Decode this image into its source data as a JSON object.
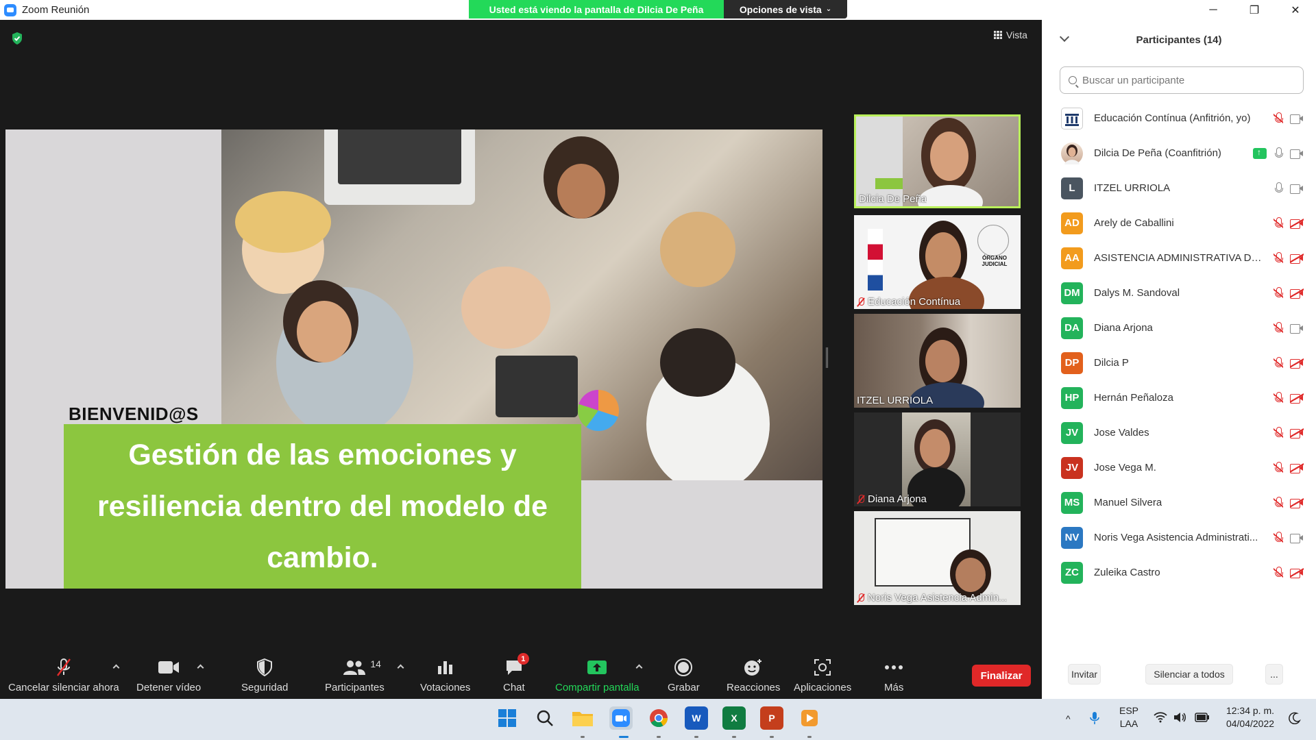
{
  "window": {
    "app_title": "Zoom Reunión",
    "viewing_banner": "Usted está viendo la pantalla de Dilcia De Peña",
    "view_options": "Opciones de vista",
    "view_button": "Vista",
    "controls": {
      "minimize": "─",
      "restore": "❐",
      "close": "✕"
    }
  },
  "slide": {
    "welcome": "BIENVENID@S",
    "title": "Gestión de las emociones y resiliencia dentro del modelo de cambio.",
    "title_bg": "#8cc63f"
  },
  "tiles": [
    {
      "name": "Dilcia De Peña",
      "muted": false,
      "active": true
    },
    {
      "name": "Educación Contínua",
      "muted": true,
      "active": false,
      "logo_text": "ÓRGANO JUDICIAL"
    },
    {
      "name": "ITZEL URRIOLA",
      "muted": false,
      "active": false
    },
    {
      "name": "Diana Arjona",
      "muted": true,
      "active": false
    },
    {
      "name": "Noris Vega Asistencia Admin...",
      "muted": true,
      "active": false
    }
  ],
  "participants_panel": {
    "title": "Participantes (14)",
    "search_placeholder": "Buscar un participante",
    "items": [
      {
        "initials": "",
        "avatar": "logo",
        "name": "Educación Contínua (Anfitrión, yo)",
        "mic": "off",
        "cam": "on",
        "sharing": false
      },
      {
        "initials": "",
        "avatar": "photo",
        "name": "Dilcia De Peña (Coanfitrión)",
        "mic": "on",
        "cam": "on",
        "sharing": true
      },
      {
        "initials": "L",
        "color": "#4a5560",
        "name": "ITZEL URRIOLA",
        "mic": "on",
        "cam": "on",
        "sharing": false
      },
      {
        "initials": "AD",
        "color": "#f29b1d",
        "name": "Arely de Caballini",
        "mic": "off",
        "cam": "off",
        "sharing": false
      },
      {
        "initials": "AA",
        "color": "#f29b1d",
        "name": "ASISTENCIA ADMINISTRATIVA DE ...",
        "mic": "off",
        "cam": "off",
        "sharing": false
      },
      {
        "initials": "DM",
        "color": "#23b35b",
        "name": "Dalys M. Sandoval",
        "mic": "off",
        "cam": "off",
        "sharing": false
      },
      {
        "initials": "DA",
        "color": "#23b35b",
        "name": "Diana Arjona",
        "mic": "off",
        "cam": "on",
        "sharing": false
      },
      {
        "initials": "DP",
        "color": "#e2601c",
        "name": "Dilcia P",
        "mic": "off",
        "cam": "off",
        "sharing": false
      },
      {
        "initials": "HP",
        "color": "#23b35b",
        "name": "Hernán Peñaloza",
        "mic": "off",
        "cam": "off",
        "sharing": false
      },
      {
        "initials": "JV",
        "color": "#23b35b",
        "name": "Jose Valdes",
        "mic": "off",
        "cam": "off",
        "sharing": false
      },
      {
        "initials": "JV",
        "color": "#c9321f",
        "name": "Jose Vega M.",
        "mic": "off",
        "cam": "off",
        "sharing": false
      },
      {
        "initials": "MS",
        "color": "#23b35b",
        "name": "Manuel Silvera",
        "mic": "off",
        "cam": "off",
        "sharing": false
      },
      {
        "initials": "NV",
        "color": "#2b78c2",
        "name": "Noris Vega Asistencia Administrati...",
        "mic": "off",
        "cam": "on",
        "sharing": false
      },
      {
        "initials": "ZC",
        "color": "#23b35b",
        "name": "Zuleika Castro",
        "mic": "off",
        "cam": "off",
        "sharing": false
      }
    ],
    "buttons": {
      "invite": "Invitar",
      "mute_all": "Silenciar a todos",
      "more": "..."
    }
  },
  "toolbar": {
    "unmute": "Cancelar silenciar ahora",
    "stop_video": "Detener vídeo",
    "security": "Seguridad",
    "participants": "Participantes",
    "participants_count": "14",
    "polls": "Votaciones",
    "chat": "Chat",
    "chat_badge": "1",
    "share": "Compartir pantalla",
    "record": "Grabar",
    "reactions": "Reacciones",
    "apps": "Aplicaciones",
    "more": "Más",
    "end": "Finalizar"
  },
  "taskbar": {
    "language": "ESP",
    "layout": "LAA",
    "time": "12:34 p. m.",
    "date": "04/04/2022"
  }
}
